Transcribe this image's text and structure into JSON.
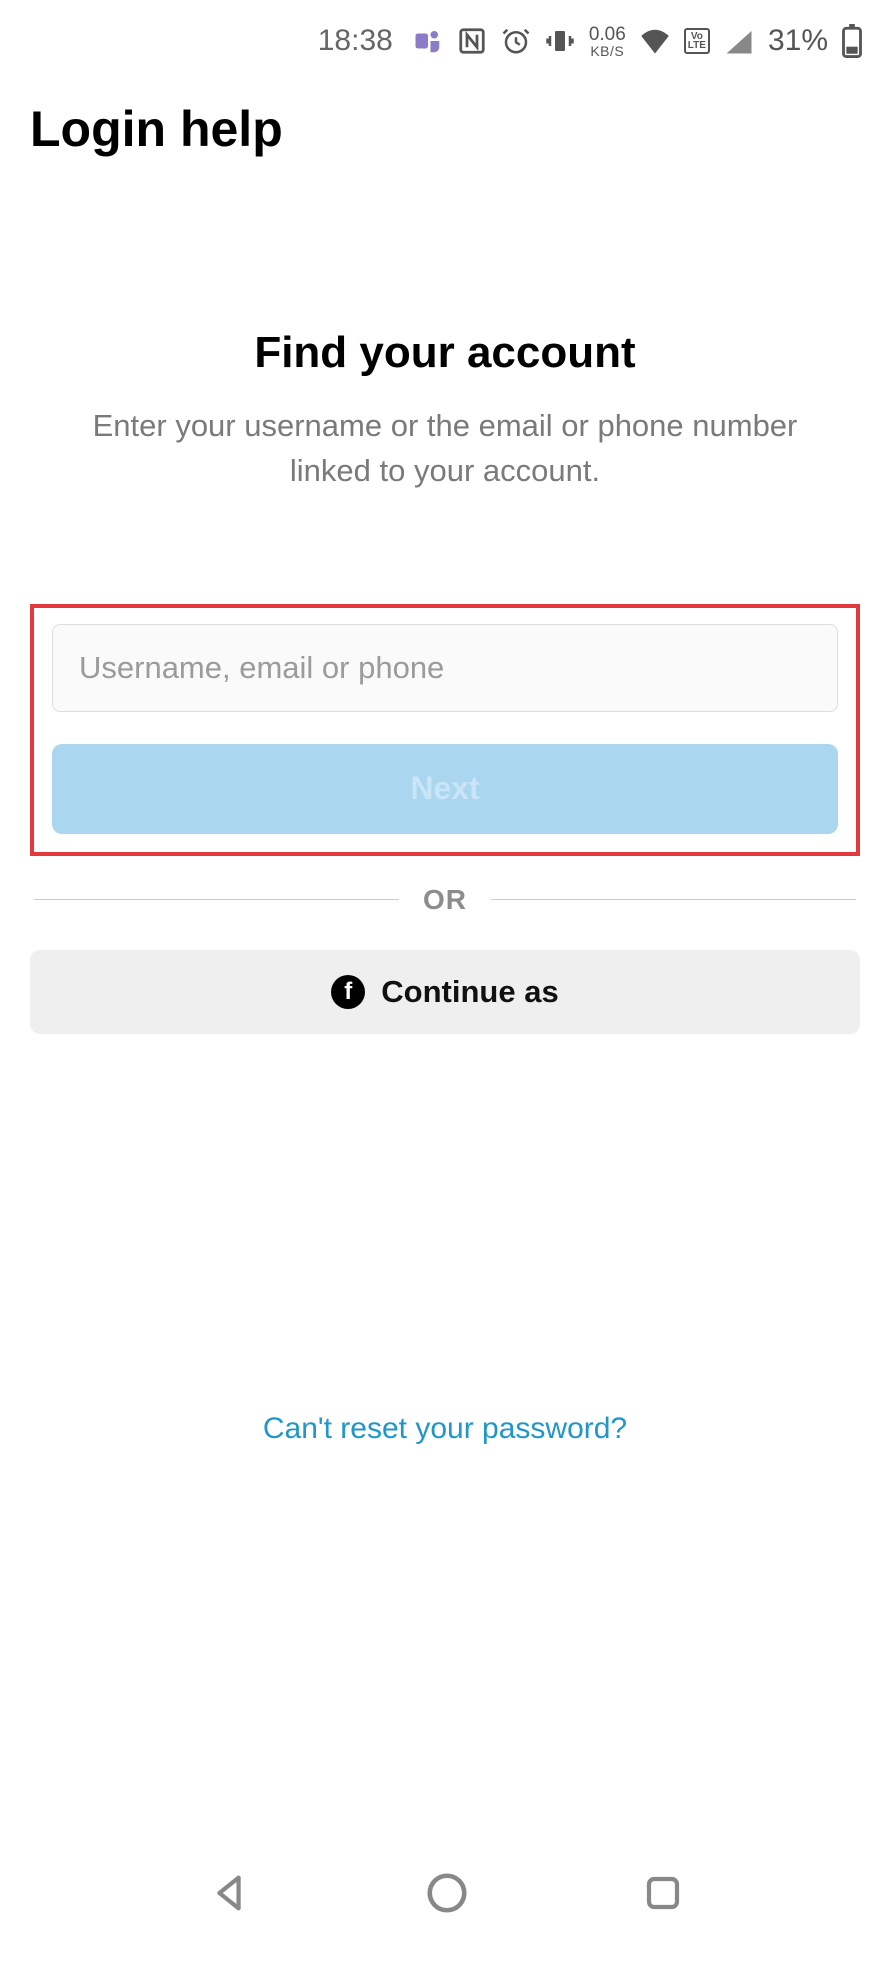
{
  "status_bar": {
    "time": "18:38",
    "data_rate_value": "0.06",
    "data_rate_unit": "KB/S",
    "volte": "Vo\nLTE",
    "battery_pct": "31%"
  },
  "header": {
    "title": "Login help"
  },
  "find_account": {
    "heading": "Find your account",
    "subtext": "Enter your username or the email or phone number linked to your account."
  },
  "form": {
    "input_placeholder": "Username, email or phone",
    "next_label": "Next"
  },
  "divider": {
    "or_label": "OR"
  },
  "facebook": {
    "continue_label": "Continue as"
  },
  "footer": {
    "cant_reset": "Can't reset your password?"
  }
}
